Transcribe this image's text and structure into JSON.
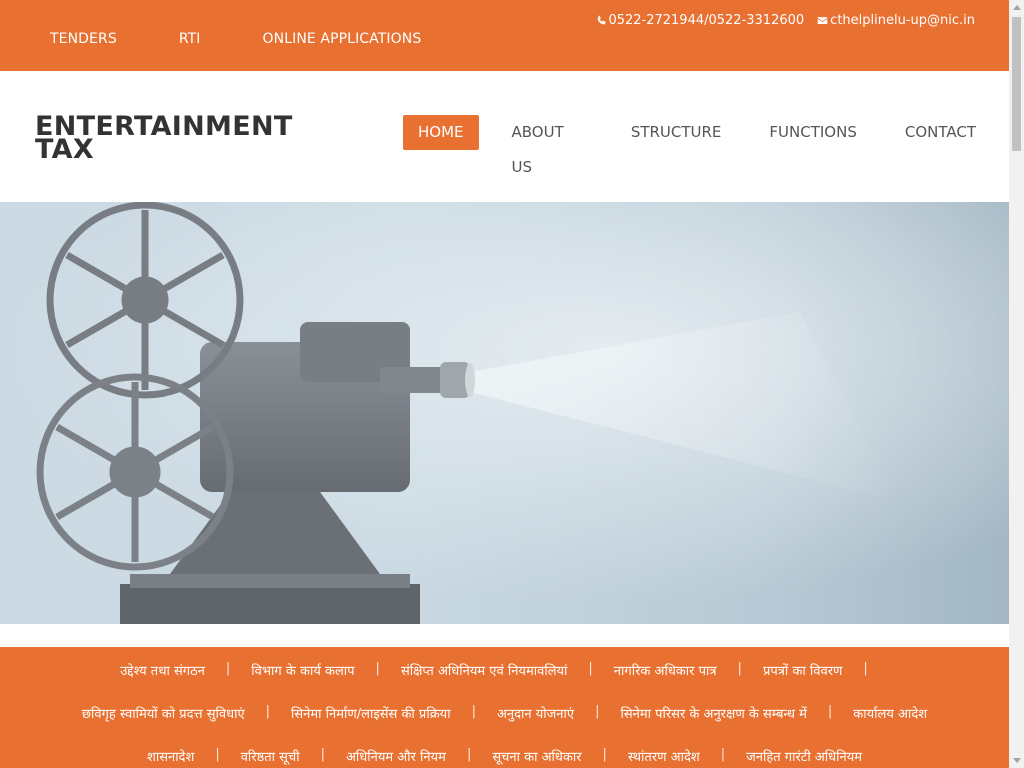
{
  "topbar": {
    "links": [
      "TENDERS",
      "RTI",
      "ONLINE APPLICATIONS"
    ],
    "phone": "0522-2721944/0522-3312600",
    "email": "cthelplinelu-up@nic.in",
    "phone_icon": "phone-icon",
    "email_icon": "envelope-icon"
  },
  "brand": {
    "line1": "ENTERTAINMENT",
    "line2": "TAX"
  },
  "nav": {
    "items": [
      "HOME",
      "ABOUT US",
      "STRUCTURE",
      "FUNCTIONS",
      "CONTACT"
    ],
    "active": "HOME"
  },
  "hero": {
    "image": "film-projector-photo"
  },
  "links": {
    "row1": [
      "उद्देश्य तथा संगठन",
      "विभाग के कार्य कलाप",
      "संक्षिप्त अधिनियम एवं नियमावलियां",
      "नागरिक अधिकार पात्र",
      "प्रपत्रों का विवरण"
    ],
    "row2": [
      "छविगृह स्वामियों को प्रदत्त सुविधाएं",
      "सिनेमा निर्माण/लाइसेंस की प्रक्रिया",
      "अनुदान योजनाएं",
      "सिनेमा परिसर के अनुरक्षण के सम्बन्ध में",
      "कार्यालय आदेश"
    ],
    "row3": [
      "शासनादेश",
      "वरिष्ठता सूची",
      "अधिनियम और नियम",
      "सूचना का अधिकार",
      "स्थांतरण आदेश",
      "जनहित गारंटी अधिनियम"
    ]
  },
  "colors": {
    "accent": "#e87030",
    "text": "#333333",
    "white": "#ffffff"
  }
}
